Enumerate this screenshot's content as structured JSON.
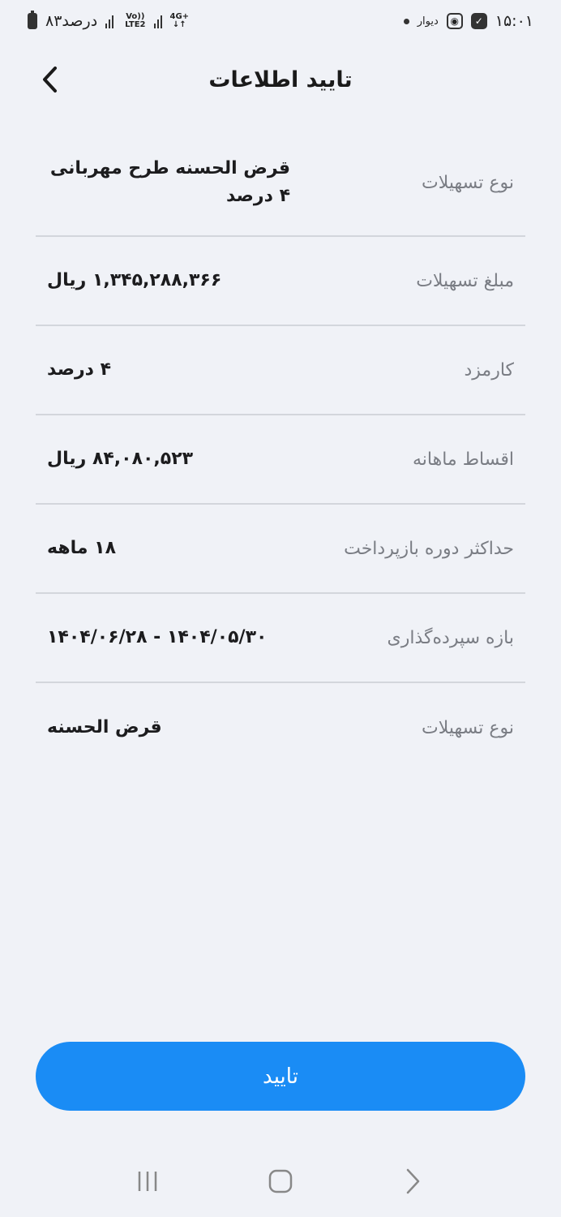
{
  "status_bar": {
    "battery_text": "۸۳درصد",
    "volte_text": "Vo))",
    "lte_text": "LTE2",
    "network_text": "4G+",
    "divar_text": "دیوار",
    "time": "۱۵:۰۱"
  },
  "header": {
    "title": "تایید اطلاعات"
  },
  "rows": [
    {
      "label": "نوع تسهیلات",
      "value": "قرض الحسنه طرح مهربانی ۴ درصد"
    },
    {
      "label": "مبلغ تسهیلات",
      "value": "۱,۳۴۵,۲۸۸,۳۶۶ ریال"
    },
    {
      "label": "کارمزد",
      "value": "۴ درصد"
    },
    {
      "label": "اقساط ماهانه",
      "value": "۸۴,۰۸۰,۵۲۳ ریال"
    },
    {
      "label": "حداکثر دوره بازپرداخت",
      "value": "۱۸ ماهه"
    },
    {
      "label": "بازه سپرده‌گذاری",
      "value": "۱۴۰۴/۰۵/۳۰ - ۱۴۰۴/۰۶/۲۸"
    },
    {
      "label": "نوع تسهیلات",
      "value": "قرض الحسنه"
    }
  ],
  "confirm_button": {
    "label": "تایید"
  },
  "colors": {
    "primary": "#1a8cf5",
    "background": "#f0f2f7",
    "label": "#7a7d84",
    "divider": "#d3d6dc"
  },
  "icons": {
    "back": "chevron-left-icon",
    "nav_recents": "recents-icon",
    "nav_home": "home-icon",
    "nav_back": "back-icon"
  }
}
